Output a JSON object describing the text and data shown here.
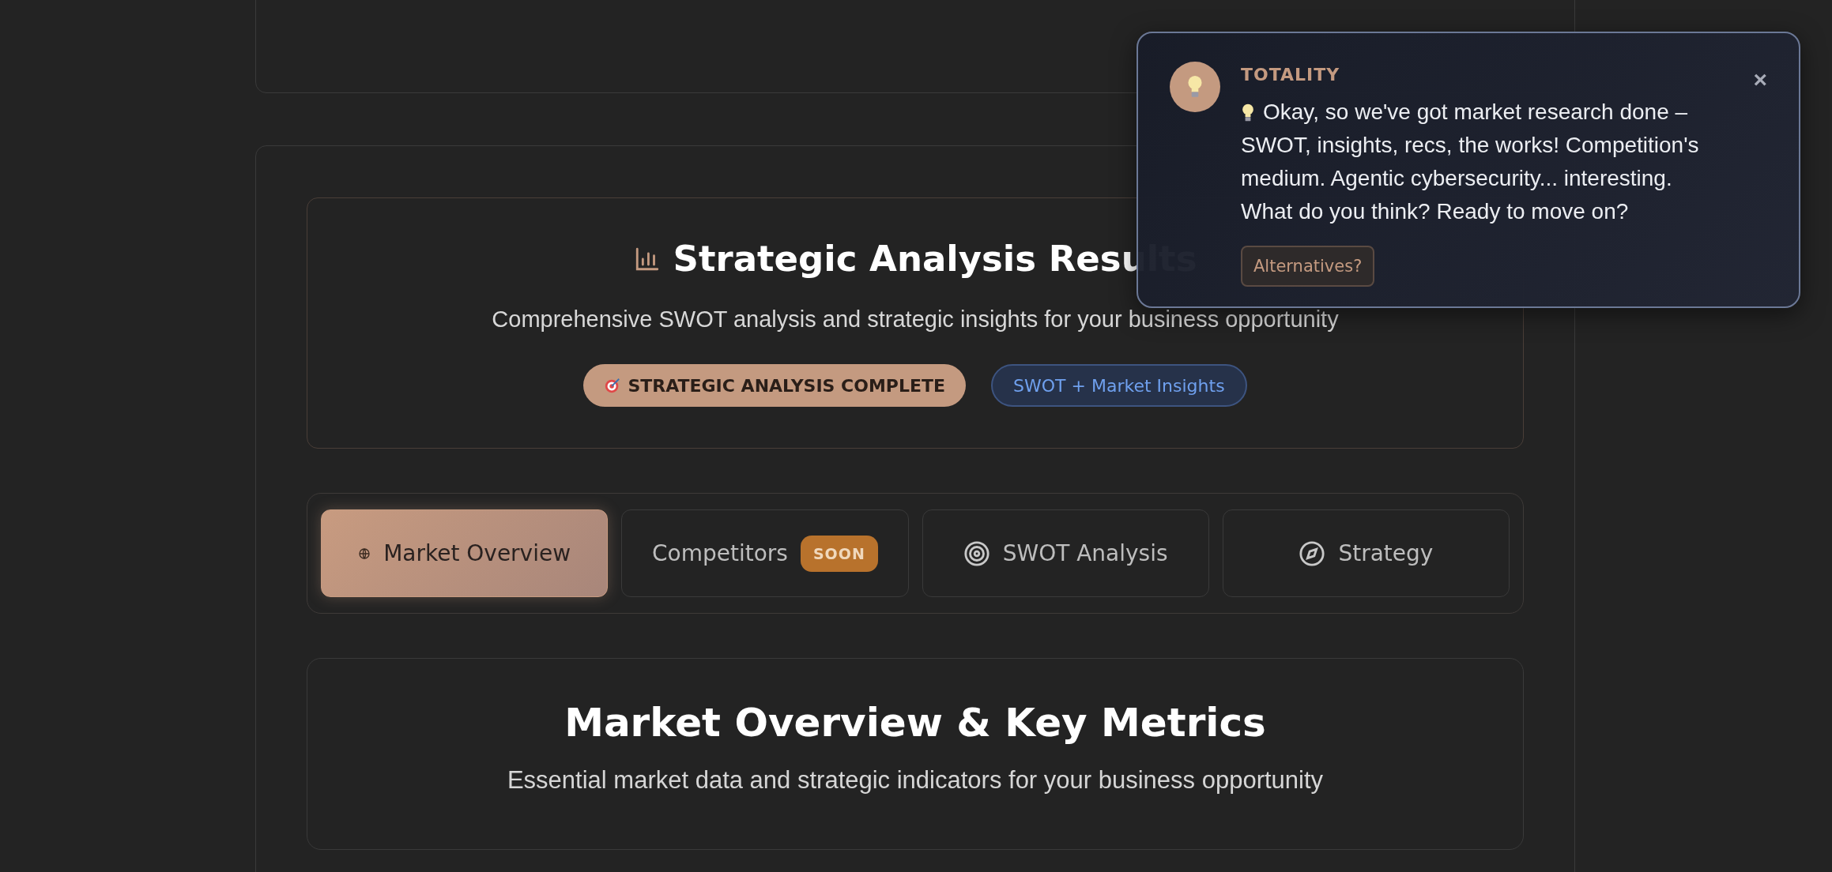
{
  "header": {
    "title": "Strategic Analysis Results",
    "subtitle": "Comprehensive SWOT analysis and strategic insights for your business opportunity",
    "badges": [
      {
        "kind": "status",
        "label": "STRATEGIC ANALYSIS COMPLETE"
      },
      {
        "kind": "info",
        "label": "SWOT + Market Insights"
      }
    ]
  },
  "tabs": [
    {
      "label": "Market Overview",
      "selected": true,
      "kind": "globe"
    },
    {
      "label": "Competitors",
      "selected": false,
      "badge": "SOON"
    },
    {
      "label": "SWOT Analysis",
      "selected": false,
      "kind": "target"
    },
    {
      "label": "Strategy",
      "selected": false,
      "kind": "compass"
    }
  ],
  "section": {
    "title": "Market Overview & Key Metrics",
    "subtitle": "Essential market data and strategic indicators for your business opportunity"
  },
  "notification": {
    "sender": "TOTALITY",
    "message": "Okay, so we've got market research done – SWOT, insights, recs, the works! Competition's medium. Agentic cybersecurity... interesting. What do you think? Ready to move on?",
    "action": "Alternatives?",
    "close": "×"
  }
}
